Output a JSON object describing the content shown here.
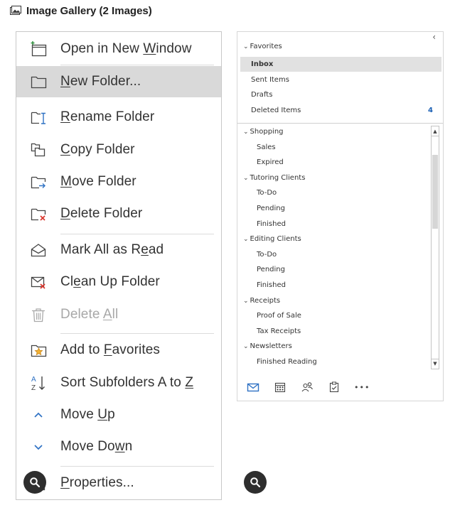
{
  "gallery": {
    "title": "Image Gallery (2 Images)"
  },
  "context_menu": {
    "items": [
      {
        "id": "open-new-window",
        "pre": "Open in New ",
        "acc": "W",
        "post": "indow",
        "enabled": true,
        "highlighted": false,
        "icon": "open-window-icon"
      },
      {
        "id": "new-folder",
        "pre": "",
        "acc": "N",
        "post": "ew Folder...",
        "enabled": true,
        "highlighted": true,
        "icon": "folder-icon"
      },
      {
        "id": "rename-folder",
        "pre": "",
        "acc": "R",
        "post": "ename Folder",
        "enabled": true,
        "highlighted": false,
        "icon": "rename-folder-icon"
      },
      {
        "id": "copy-folder",
        "pre": "",
        "acc": "C",
        "post": "opy Folder",
        "enabled": true,
        "highlighted": false,
        "icon": "copy-folder-icon"
      },
      {
        "id": "move-folder",
        "pre": "",
        "acc": "M",
        "post": "ove Folder",
        "enabled": true,
        "highlighted": false,
        "icon": "move-folder-icon"
      },
      {
        "id": "delete-folder",
        "pre": "",
        "acc": "D",
        "post": "elete Folder",
        "enabled": true,
        "highlighted": false,
        "icon": "delete-folder-icon"
      },
      {
        "id": "mark-all-read",
        "pre": "Mark All as R",
        "acc": "e",
        "post": "ad",
        "enabled": true,
        "highlighted": false,
        "icon": "open-envelope-icon"
      },
      {
        "id": "clean-up-folder",
        "pre": "Cl",
        "acc": "e",
        "post": "an Up Folder",
        "enabled": true,
        "highlighted": false,
        "icon": "clean-up-icon"
      },
      {
        "id": "delete-all",
        "pre": "Delete ",
        "acc": "A",
        "post": "ll",
        "enabled": false,
        "highlighted": false,
        "icon": "trash-icon"
      },
      {
        "id": "add-to-favorites",
        "pre": "Add to ",
        "acc": "F",
        "post": "avorites",
        "enabled": true,
        "highlighted": false,
        "icon": "favorites-star-icon"
      },
      {
        "id": "sort-subfolders",
        "pre": "Sort Subfolders A to ",
        "acc": "Z",
        "post": "",
        "enabled": true,
        "highlighted": false,
        "icon": "sort-az-icon"
      },
      {
        "id": "move-up",
        "pre": "Move ",
        "acc": "U",
        "post": "p",
        "enabled": true,
        "highlighted": false,
        "icon": "chevron-up-icon"
      },
      {
        "id": "move-down",
        "pre": "Move Do",
        "acc": "w",
        "post": "n",
        "enabled": true,
        "highlighted": false,
        "icon": "chevron-down-icon"
      },
      {
        "id": "properties",
        "pre": "",
        "acc": "P",
        "post": "roperties...",
        "enabled": true,
        "highlighted": false,
        "icon": "properties-icon"
      }
    ]
  },
  "folder_pane": {
    "collapse_icon": "chevron-left-icon",
    "favorites": {
      "label": "Favorites",
      "items": [
        {
          "label": "Inbox",
          "selected": true,
          "count": ""
        },
        {
          "label": "Sent Items",
          "selected": false,
          "count": ""
        },
        {
          "label": "Drafts",
          "selected": false,
          "count": ""
        },
        {
          "label": "Deleted Items",
          "selected": false,
          "count": "4"
        }
      ]
    },
    "groups": [
      {
        "label": "Shopping",
        "children": [
          "Sales",
          "Expired"
        ]
      },
      {
        "label": "Tutoring Clients",
        "children": [
          "To-Do",
          "Pending",
          "Finished"
        ]
      },
      {
        "label": "Editing Clients",
        "children": [
          "To-Do",
          "Pending",
          "Finished"
        ]
      },
      {
        "label": "Receipts",
        "children": [
          "Proof of Sale",
          "Tax Receipts"
        ]
      },
      {
        "label": "Newsletters",
        "children": [
          "Finished Reading"
        ]
      }
    ],
    "nav_icons": [
      "mail-icon",
      "calendar-icon",
      "people-icon",
      "tasks-icon",
      "more-icon"
    ],
    "more_label": "•••"
  },
  "colors": {
    "highlight": "#d9d9d9",
    "badge": "#1a5fb4",
    "accent": "#2f72c4",
    "delete_red": "#d9342b",
    "zoom_button": "#2e2e2e"
  }
}
